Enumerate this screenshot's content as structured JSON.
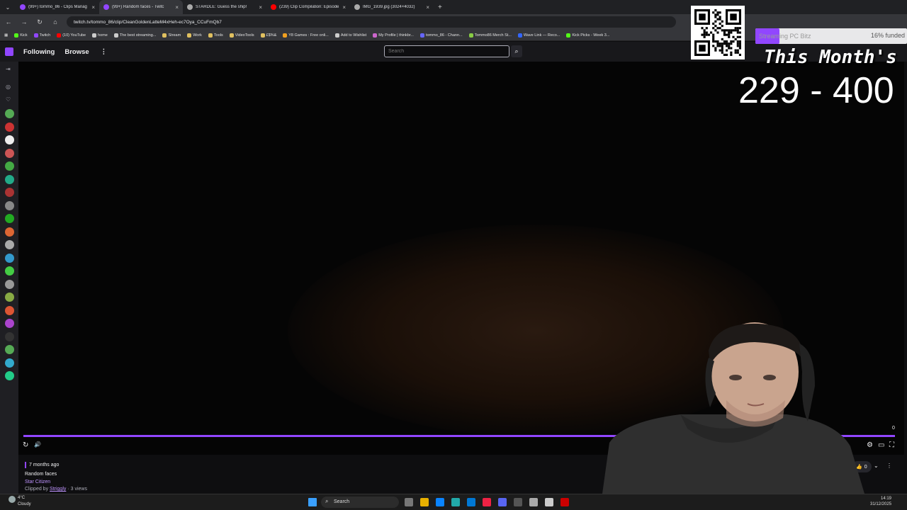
{
  "browser": {
    "tabs": [
      {
        "title": "(99+) tommo_86 - Clips Manag",
        "color": "#9146ff"
      },
      {
        "title": "(99+) Random faces - Twitc",
        "color": "#9146ff"
      },
      {
        "title": "STARDLE: Guess the ship!",
        "color": "#aaaaaa"
      },
      {
        "title": "(239) Clip Compilation: Episode",
        "color": "#ff0000"
      },
      {
        "title": "IMG_1939.jpg (3024×4032)",
        "color": "#aaaaaa"
      }
    ],
    "url": "twitch.tv/tommo_86/clip/CleanGoldenLatteM4xHeh-ec7Oya_CCuFmQb7",
    "bookmarks": [
      {
        "label": "Kick",
        "color": "#53fc18"
      },
      {
        "label": "Twitch",
        "color": "#9146ff"
      },
      {
        "label": "(10) YouTube",
        "color": "#ff0000"
      },
      {
        "label": "home",
        "color": "#cccccc"
      },
      {
        "label": "The best streaming...",
        "color": "#cccccc"
      },
      {
        "label": "Stream",
        "color": "#e0c060"
      },
      {
        "label": "Work",
        "color": "#e0c060"
      },
      {
        "label": "Tools",
        "color": "#e0c060"
      },
      {
        "label": "VideoTools",
        "color": "#e0c060"
      },
      {
        "label": "£$%&",
        "color": "#e0c060"
      },
      {
        "label": "Y8 Games : Free onli...",
        "color": "#f0a020"
      },
      {
        "label": "Add to Wishlist",
        "color": "#cccccc"
      },
      {
        "label": "My Profile | thinkbr...",
        "color": "#cc66cc"
      },
      {
        "label": "tommo_86 - Chann...",
        "color": "#6666ff"
      },
      {
        "label": "Tommo86 Merch St...",
        "color": "#88cc44"
      },
      {
        "label": "Wave Link — Reco...",
        "color": "#3366ff"
      },
      {
        "label": "Kick Picks - Week 3...",
        "color": "#53fc18"
      }
    ]
  },
  "twitch": {
    "nav": {
      "following": "Following",
      "browse": "Browse",
      "more": "⋮"
    },
    "search_placeholder": "Search",
    "sidebar_colors": [
      "#5a5",
      "#c33",
      "#eee",
      "#c55",
      "#4a4",
      "#2a8",
      "#a33",
      "#888",
      "#2a2",
      "#d63",
      "#aaa",
      "#39c",
      "#4c4",
      "#999",
      "#8a4",
      "#d53",
      "#a4c",
      "#333",
      "#5a5",
      "#3ac",
      "#2c8"
    ]
  },
  "video": {
    "controls": {
      "replay": "↻",
      "volume": "🔊",
      "settings": "⚙",
      "theatre": "▭",
      "fullscreen": "⛶"
    },
    "progress_count": "0"
  },
  "clip": {
    "age": "7 months ago",
    "title": "Random faces",
    "category": "Star Citizen",
    "clipped_by_prefix": "Clipped by",
    "clipped_by_user": "Striggly",
    "views": "· 3 views",
    "likes": "0"
  },
  "overlay": {
    "title": "This Month's",
    "range": "229 - 400",
    "goal_label": "Streaming PC Bitz",
    "goal_percent": "16% funded",
    "goal_fraction": 0.16
  },
  "taskbar": {
    "weather_temp": "4°C",
    "weather_desc": "Cloudy",
    "search": "Search",
    "time": "14:19",
    "date": "31/12/2025"
  }
}
